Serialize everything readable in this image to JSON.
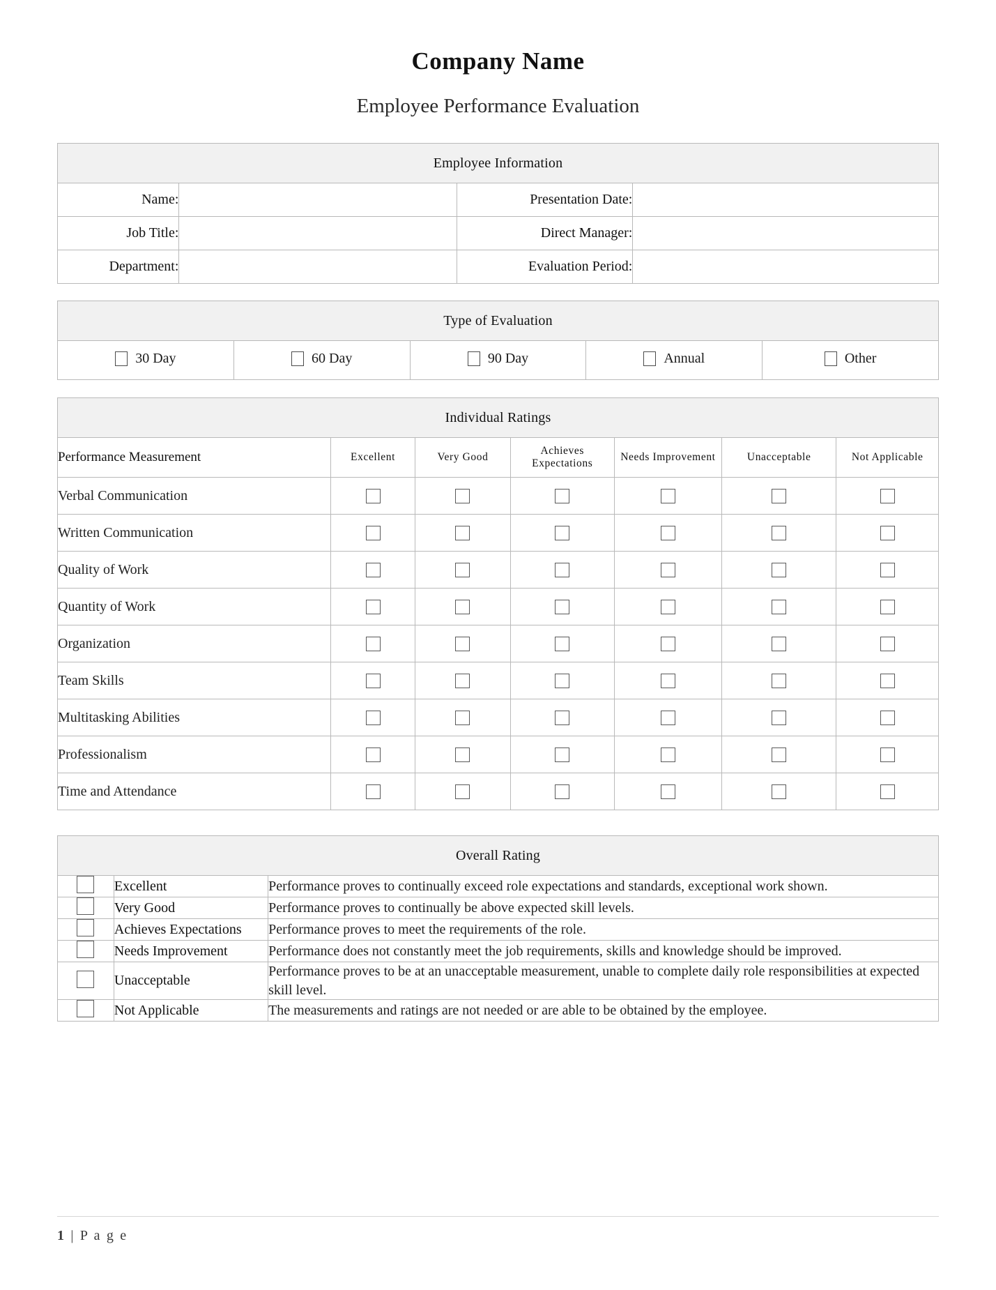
{
  "document": {
    "title": "Company Name",
    "subtitle": "Employee Performance Evaluation"
  },
  "employee_information": {
    "section_title": "Employee Information",
    "rows": [
      {
        "left_label": "Name:",
        "left_value": "",
        "right_label": "Presentation Date:",
        "right_value": ""
      },
      {
        "left_label": "Job Title:",
        "left_value": "",
        "right_label": "Direct Manager:",
        "right_value": ""
      },
      {
        "left_label": "Department:",
        "left_value": "",
        "right_label": "Evaluation Period:",
        "right_value": ""
      }
    ]
  },
  "type_of_evaluation": {
    "section_title": "Type of Evaluation",
    "options": [
      {
        "label": "30 Day",
        "checked": false
      },
      {
        "label": "60 Day",
        "checked": false
      },
      {
        "label": "90 Day",
        "checked": false
      },
      {
        "label": "Annual",
        "checked": false
      },
      {
        "label": "Other",
        "checked": false
      }
    ]
  },
  "individual_ratings": {
    "section_title": "Individual Ratings",
    "first_column_header": "Performance Measurement",
    "rating_columns": [
      "Excellent",
      "Very Good",
      "Achieves Expectations",
      "Needs Improvement",
      "Unacceptable",
      "Not Applicable"
    ],
    "measurements": [
      "Verbal Communication",
      "Written Communication",
      "Quality of Work",
      "Quantity of Work",
      "Organization",
      "Team Skills",
      "Multitasking Abilities",
      "Professionalism",
      "Time and Attendance"
    ]
  },
  "overall_rating": {
    "section_title": "Overall Rating",
    "rows": [
      {
        "label": "Excellent",
        "description": "Performance proves to continually exceed role expectations and standards, exceptional work shown.",
        "checked": false
      },
      {
        "label": "Very Good",
        "description": "Performance proves to continually be above expected skill levels.",
        "checked": false
      },
      {
        "label": "Achieves Expectations",
        "description": "Performance proves to meet the requirements of the role.",
        "checked": false
      },
      {
        "label": "Needs Improvement",
        "description": "Performance does not constantly meet the job requirements, skills and knowledge should be improved.",
        "checked": false
      },
      {
        "label": "Unacceptable",
        "description": "Performance proves to be at an unacceptable measurement, unable to complete daily role responsibilities at expected skill level.",
        "checked": false
      },
      {
        "label": "Not Applicable",
        "description": "The measurements and ratings are not needed or are able to be obtained by the employee.",
        "checked": false
      }
    ]
  },
  "footer": {
    "page_number": "1",
    "separator": "|",
    "page_word": "P a g e"
  },
  "colors": {
    "section_header_bg": "#f1f1f1",
    "border": "#b9b9b9",
    "checkbox_border": "#595959",
    "text": "#1a1a1a"
  }
}
